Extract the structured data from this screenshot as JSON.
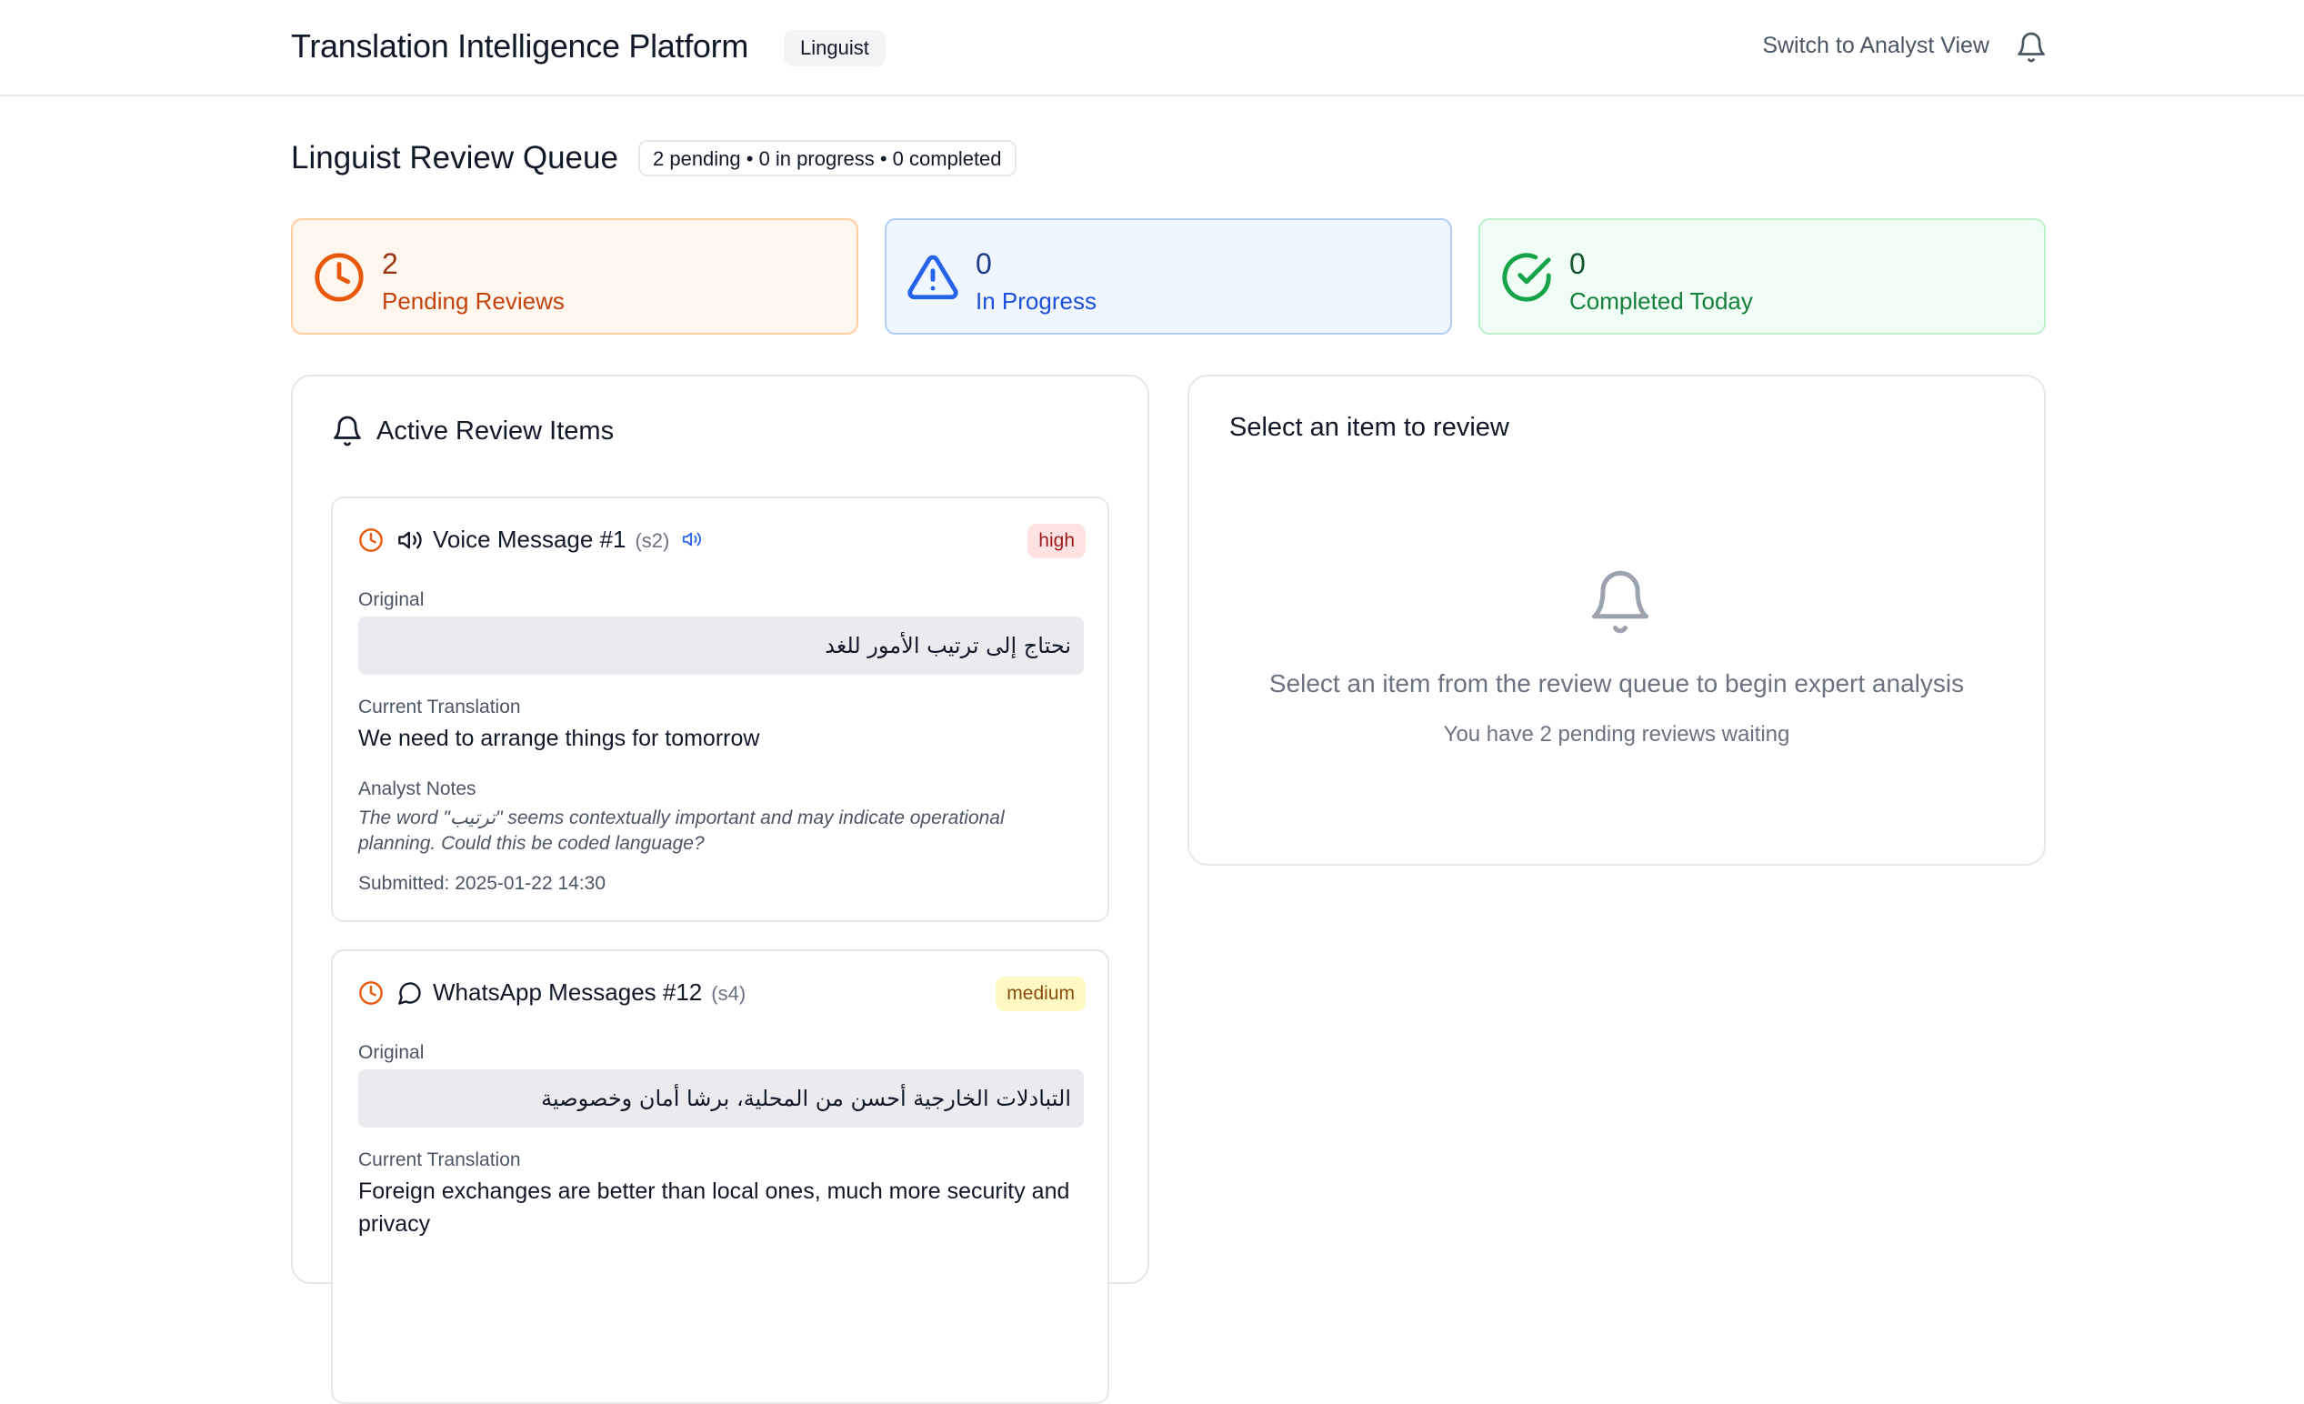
{
  "header": {
    "app_title": "Translation Intelligence Platform",
    "role_badge": "Linguist",
    "switch_view_label": "Switch to Analyst View",
    "notification_icon": "bell-icon"
  },
  "queue_header": {
    "title": "Linguist Review Queue",
    "summary": "2 pending • 0 in progress • 0 completed"
  },
  "stats": {
    "pending": {
      "value": "2",
      "label": "Pending Reviews",
      "icon": "clock-icon",
      "color": "#ea580c"
    },
    "in_progress": {
      "value": "0",
      "label": "In Progress",
      "icon": "alert-triangle-icon",
      "color": "#2563eb"
    },
    "completed": {
      "value": "0",
      "label": "Completed Today",
      "icon": "check-circle-icon",
      "color": "#16a34a"
    }
  },
  "review_panel": {
    "title": "Active Review Items",
    "items": [
      {
        "title": "Voice Message #1",
        "id": "(s2)",
        "type_icon": "speaker-icon",
        "priority": "high",
        "original_label": "Original",
        "original_text": "نحتاج إلى ترتيب الأمور للغد",
        "translation_label": "Current Translation",
        "translation_text": "We need to arrange things for tomorrow",
        "notes_label": "Analyst Notes",
        "notes_text": "The word \"ترتيب\" seems contextually important and may indicate operational planning. Could this be coded language?",
        "submitted": "Submitted: 2025-01-22 14:30"
      },
      {
        "title": "WhatsApp Messages #12",
        "id": "(s4)",
        "type_icon": "chat-bubble-icon",
        "priority": "medium",
        "original_label": "Original",
        "original_text": "التبادلات الخارجية أحسن من المحلية، برشا أمان وخصوصية",
        "translation_label": "Current Translation",
        "translation_text": "Foreign exchanges are better than local ones, much more security and privacy"
      }
    ]
  },
  "detail_panel": {
    "title": "Select an item to review",
    "empty_message": "Select an item from the review queue to begin expert analysis",
    "empty_sub": "You have 2 pending reviews waiting"
  }
}
